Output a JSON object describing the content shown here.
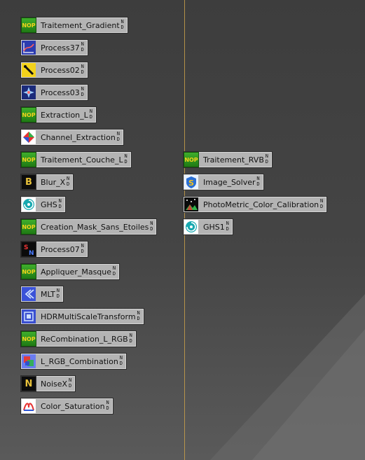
{
  "colors": {
    "canvas": "#3d3d3d",
    "node_bg": "#b4b4b4",
    "divider": "#c9a04a",
    "nop_green": "#2e8f20",
    "nop_text": "#f2d21c"
  },
  "corner_flag": [
    "N",
    "D"
  ],
  "left_column": [
    {
      "label": "Traitement_Gradient",
      "icon": "nop-icon",
      "icon_text": "NOP"
    },
    {
      "label": "Process37",
      "icon": "graph-icon"
    },
    {
      "label": "Process02",
      "icon": "wand-icon"
    },
    {
      "label": "Process03",
      "icon": "star-burst-icon"
    },
    {
      "label": "Extraction_L",
      "icon": "nop-icon",
      "icon_text": "NOP"
    },
    {
      "label": "Channel_Extraction",
      "icon": "channel-prism-icon"
    },
    {
      "label": "Traitement_Couche_L",
      "icon": "nop-icon",
      "icon_text": "NOP"
    },
    {
      "label": "Blur_X",
      "icon": "blur-x-icon",
      "icon_text": "B"
    },
    {
      "label": "GHS",
      "icon": "ghs-icon"
    },
    {
      "label": "Creation_Mask_Sans_Etoiles",
      "icon": "nop-icon",
      "icon_text": "NOP"
    },
    {
      "label": "Process07",
      "icon": "sn-icon",
      "icon_text": "SN"
    },
    {
      "label": "Appliquer_Masque",
      "icon": "nop-icon",
      "icon_text": "NOP"
    },
    {
      "label": "MLT",
      "icon": "mlt-icon"
    },
    {
      "label": "HDRMultiScaleTransform",
      "icon": "hdr-icon"
    },
    {
      "label": "ReCombination_L_RGB",
      "icon": "nop-icon",
      "icon_text": "NOP"
    },
    {
      "label": "L_RGB_Combination",
      "icon": "lrgb-icon"
    },
    {
      "label": "NoiseX",
      "icon": "noise-x-icon",
      "icon_text": "N"
    },
    {
      "label": "Color_Saturation",
      "icon": "color-saturation-icon"
    }
  ],
  "right_column": [
    {
      "label": "Traitement_RVB",
      "icon": "nop-icon",
      "icon_text": "NOP"
    },
    {
      "label": "Image_Solver",
      "icon": "image-solver-icon",
      "icon_text": "S"
    },
    {
      "label": "PhotoMetric_Color_Calibration",
      "icon": "photometric-icon"
    },
    {
      "label": "GHS1",
      "icon": "ghs-icon"
    }
  ]
}
